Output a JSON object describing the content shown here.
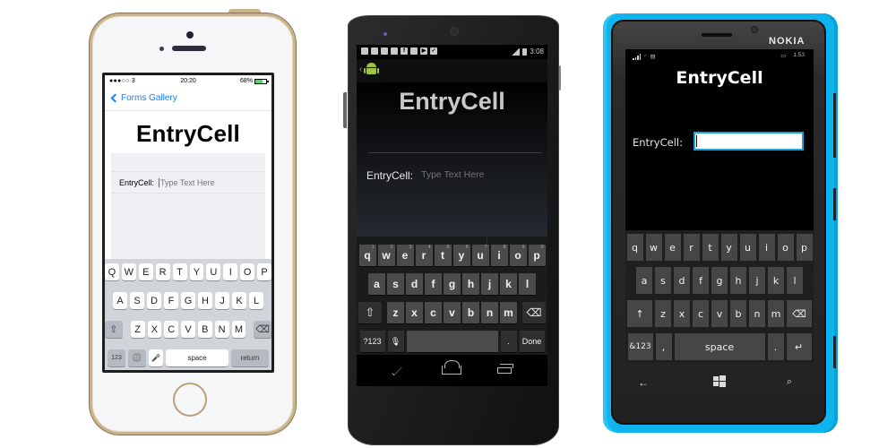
{
  "ios": {
    "status": {
      "carrier": "●●●○○ 3",
      "time": "20:20",
      "battery": "68%",
      "battery_level": 0.68
    },
    "nav": {
      "back_label": "Forms Gallery"
    },
    "title": "EntryCell",
    "cell": {
      "label": "EntryCell:",
      "placeholder": "Type Text Here",
      "value": ""
    },
    "keyboard": {
      "row1": [
        "Q",
        "W",
        "E",
        "R",
        "T",
        "Y",
        "U",
        "I",
        "O",
        "P"
      ],
      "row2": [
        "A",
        "S",
        "D",
        "F",
        "G",
        "H",
        "J",
        "K",
        "L"
      ],
      "row3": [
        "Z",
        "X",
        "C",
        "V",
        "B",
        "N",
        "M"
      ],
      "numbers_label": "123",
      "space_label": "space",
      "return_label": "return",
      "shift_icon": "⇧",
      "delete_icon": "⌫",
      "globe_icon": "🌐",
      "mic_icon": "🎤"
    }
  },
  "android": {
    "status": {
      "time": "3:08"
    },
    "notifications": [
      "chat-icon",
      "chat-icon",
      "image-icon",
      "gmail-icon",
      "facebook-icon",
      "person-add-icon",
      "play-store-icon",
      "clipboard-check-icon"
    ],
    "title": "EntryCell",
    "cell": {
      "label": "EntryCell:",
      "placeholder": "Type Text Here",
      "value": ""
    },
    "keyboard": {
      "row1": [
        "q",
        "w",
        "e",
        "r",
        "t",
        "y",
        "u",
        "i",
        "o",
        "p"
      ],
      "row1_hints": [
        "1",
        "2",
        "3",
        "4",
        "5",
        "6",
        "7",
        "8",
        "9",
        "0"
      ],
      "row2": [
        "a",
        "s",
        "d",
        "f",
        "g",
        "h",
        "j",
        "k",
        "l"
      ],
      "row3": [
        "z",
        "x",
        "c",
        "v",
        "b",
        "n",
        "m"
      ],
      "symbols_label": "?123",
      "period_label": ".",
      "done_label": "Done",
      "shift_icon": "⇧",
      "delete_icon": "⌫",
      "mic_icon": "🎙"
    }
  },
  "windows_phone": {
    "brand": "NOKIA",
    "status": {
      "time": "1:53"
    },
    "title": "EntryCell",
    "cell": {
      "label": "EntryCell:",
      "value": ""
    },
    "keyboard": {
      "row1": [
        "q",
        "w",
        "e",
        "r",
        "t",
        "y",
        "u",
        "i",
        "o",
        "p"
      ],
      "row2": [
        "a",
        "s",
        "d",
        "f",
        "g",
        "h",
        "j",
        "k",
        "l"
      ],
      "row3": [
        "z",
        "x",
        "c",
        "v",
        "b",
        "n",
        "m"
      ],
      "symbols_label": "&123",
      "comma_label": ",",
      "space_label": "space",
      "period_label": ".",
      "shift_icon": "↑",
      "delete_icon": "⌫",
      "enter_icon": "↵"
    },
    "nav": {
      "back_icon": "←",
      "search_icon": "⌕"
    }
  }
}
